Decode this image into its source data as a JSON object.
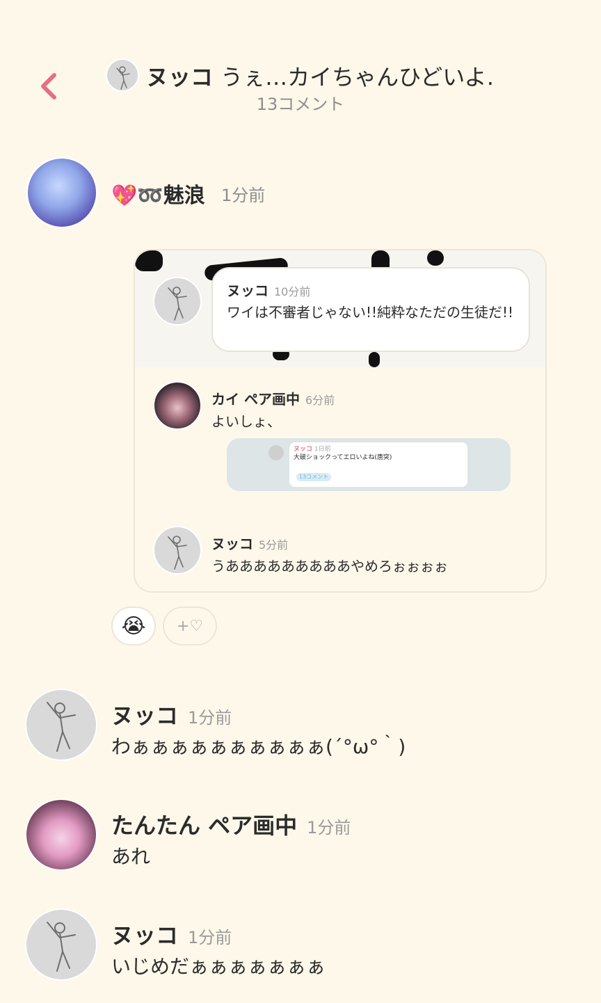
{
  "header": {
    "poster_name": "ヌッコ",
    "post_title": "うぇ…カイちゃんひどいよ…",
    "comment_count": "13コメント"
  },
  "comments": [
    {
      "author": "💖➿魅浪",
      "time": "1分前",
      "quote": {
        "items": [
          {
            "author": "ヌッコ",
            "time": "10分前",
            "text": "ワイは不審者じゃない!!純粋なただの生徒だ!!"
          },
          {
            "author": "カイ ペア画中",
            "time": "6分前",
            "text": "よいしょ、",
            "embed": {
              "author": "ヌッコ",
              "time": "1日前",
              "title": "大破ショックってエロいよね(唐突)",
              "count": "13コメント"
            }
          },
          {
            "author": "ヌッコ",
            "time": "5分前",
            "text": "うあああああああああやめろぉぉぉぉ"
          }
        ]
      },
      "reactions": [
        {
          "emoji": "😭"
        },
        {
          "label": "+♡"
        }
      ]
    },
    {
      "author": "ヌッコ",
      "time": "1分前",
      "text": "わぁぁぁぁぁぁぁぁぁぁ(´°ω°｀)"
    },
    {
      "author": "たんたん ペア画中",
      "time": "1分前",
      "text": "あれ"
    },
    {
      "author": "ヌッコ",
      "time": "1分前",
      "text": "いじめだぁぁぁぁぁぁぁ"
    }
  ],
  "colors": {
    "accent": "#e46f86",
    "background": "#fdf8ea"
  }
}
